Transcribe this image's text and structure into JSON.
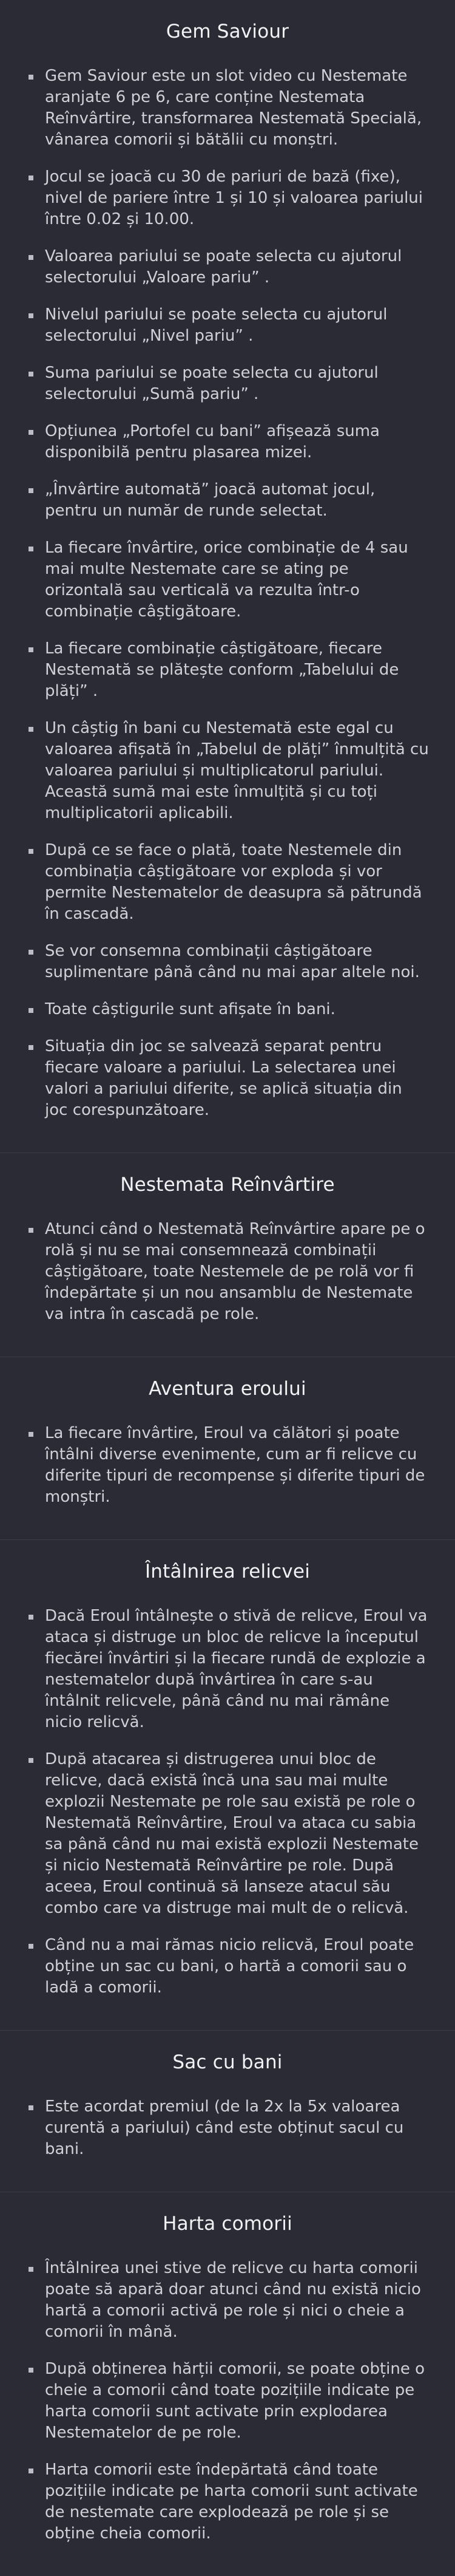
{
  "sections": [
    {
      "title": "Gem Saviour",
      "items": [
        "Gem Saviour este un slot video cu Nestemate aranjate 6 pe 6, care conține Nestemata Reînvârtire, transformarea Nestemată Specială, vânarea comorii și bătălii cu monștri.",
        "Jocul se joacă cu 30 de pariuri de bază (fixe), nivel de pariere între 1 și 10 și valoarea pariului între 0.02 și 10.00.",
        "Valoarea pariului se poate selecta cu ajutorul selectorului „Valoare pariu” .",
        "Nivelul pariului se poate selecta cu ajutorul selectorului „Nivel pariu” .",
        "Suma pariului se poate selecta cu ajutorul selectorului „Sumă pariu” .",
        "Opțiunea „Portofel cu bani”   afișează suma disponibilă pentru plasarea mizei.",
        "„Învârtire automată”   joacă automat jocul, pentru un număr de runde selectat.",
        "La fiecare învârtire, orice combinație de 4 sau mai multe Nestemate care se ating pe orizontală sau verticală va rezulta într-o combinație câștigătoare.",
        "La fiecare combinație câștigătoare, fiecare Nestemată se plătește conform „Tabelului de plăți” .",
        "Un câștig în bani cu Nestemată este egal cu valoarea afișată în „Tabelul de plăți”   înmulțită cu valoarea pariului și multiplicatorul pariului. Această sumă mai este înmulțită și cu toți multiplicatorii aplicabili.",
        "După ce se face o plată, toate Nestemele din combinația câștigătoare vor exploda și vor permite Nestematelor de deasupra să pătrundă în cascadă.",
        "Se vor consemna combinații câștigătoare suplimentare până când nu mai apar altele noi.",
        "Toate câștigurile sunt afișate în bani.",
        "Situația din joc se salvează separat pentru fiecare valoare a pariului. La selectarea unei valori a pariului diferite, se aplică situația din joc corespunzătoare."
      ]
    },
    {
      "title": "Nestemata Reînvârtire",
      "items": [
        "Atunci când o Nestemată Reînvârtire apare pe o rolă și nu se mai consemnează combinații câștigătoare, toate Nestemele de pe rolă vor fi îndepărtate și un nou ansamblu de Nestemate va intra în cascadă pe role."
      ]
    },
    {
      "title": "Aventura eroului",
      "items": [
        "La fiecare învârtire, Eroul va călători și poate întâlni diverse evenimente, cum ar fi relicve cu diferite tipuri de recompense și diferite tipuri de monștri."
      ]
    },
    {
      "title": "Întâlnirea relicvei",
      "items": [
        "Dacă Eroul întâlnește o stivă de relicve, Eroul va ataca și distruge un bloc de relicve la începutul fiecărei învârtiri și la fiecare rundă de explozie a nestematelor după învârtirea în care s-au întâlnit relicvele, până când nu mai rămâne nicio relicvă.",
        "După atacarea și distrugerea unui bloc de relicve, dacă există încă una sau mai multe explozii Nestemate pe role sau există pe role o Nestemată Reînvârtire, Eroul va ataca cu sabia sa până când nu mai există explozii Nestemate și nicio Nestemată Reînvârtire pe role. După aceea, Eroul continuă să lanseze atacul său combo care va distruge mai mult de o relicvă.",
        "Când nu a mai rămas nicio relicvă, Eroul poate obține un sac cu bani, o hartă a comorii sau o ladă a comorii."
      ]
    },
    {
      "title": "Sac cu bani",
      "items": [
        "Este acordat premiul (de la 2x la 5x valoarea curentă a pariului) când este obținut sacul cu bani."
      ]
    },
    {
      "title": "Harta comorii",
      "items": [
        "Întâlnirea unei stive de relicve cu harta comorii poate să apară doar atunci când nu există nicio hartă a comorii activă pe role și nici o cheie a comorii în mână.",
        "După obținerea hărții comorii, se poate obține o cheie a comorii când toate pozițiile indicate pe harta comorii sunt activate prin explodarea Nestematelor de pe role.",
        "Harta comorii este îndepărtată când toate pozițiile indicate pe harta comorii sunt activate de nestemate care explodează pe role și se obține cheia comorii."
      ]
    }
  ]
}
